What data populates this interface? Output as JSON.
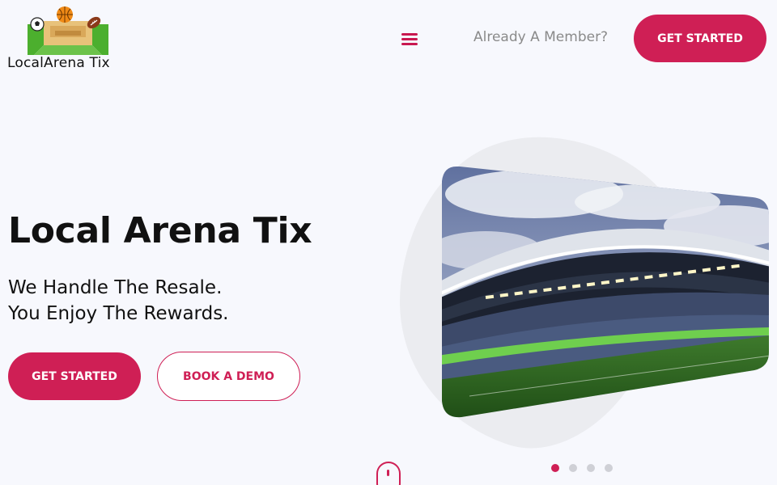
{
  "header": {
    "logo_text": "LocalArena Tix",
    "member_link": "Already A Member?",
    "cta_label": "GET STARTED"
  },
  "hero": {
    "title": "Local Arena Tix",
    "subtitle_line1": "We Handle The Resale.",
    "subtitle_line2": "You Enjoy The Rewards.",
    "primary_cta": "GET STARTED",
    "secondary_cta": "BOOK A DEMO"
  },
  "carousel": {
    "slide_count": 4,
    "active_index": 0
  },
  "colors": {
    "accent": "#cf1f55",
    "background": "#f7f8fd",
    "muted_text": "#8a8a8a"
  },
  "icons": [
    "hamburger-menu-icon",
    "scroll-mouse-icon",
    "soccer-ball-icon",
    "basketball-icon",
    "football-icon"
  ]
}
